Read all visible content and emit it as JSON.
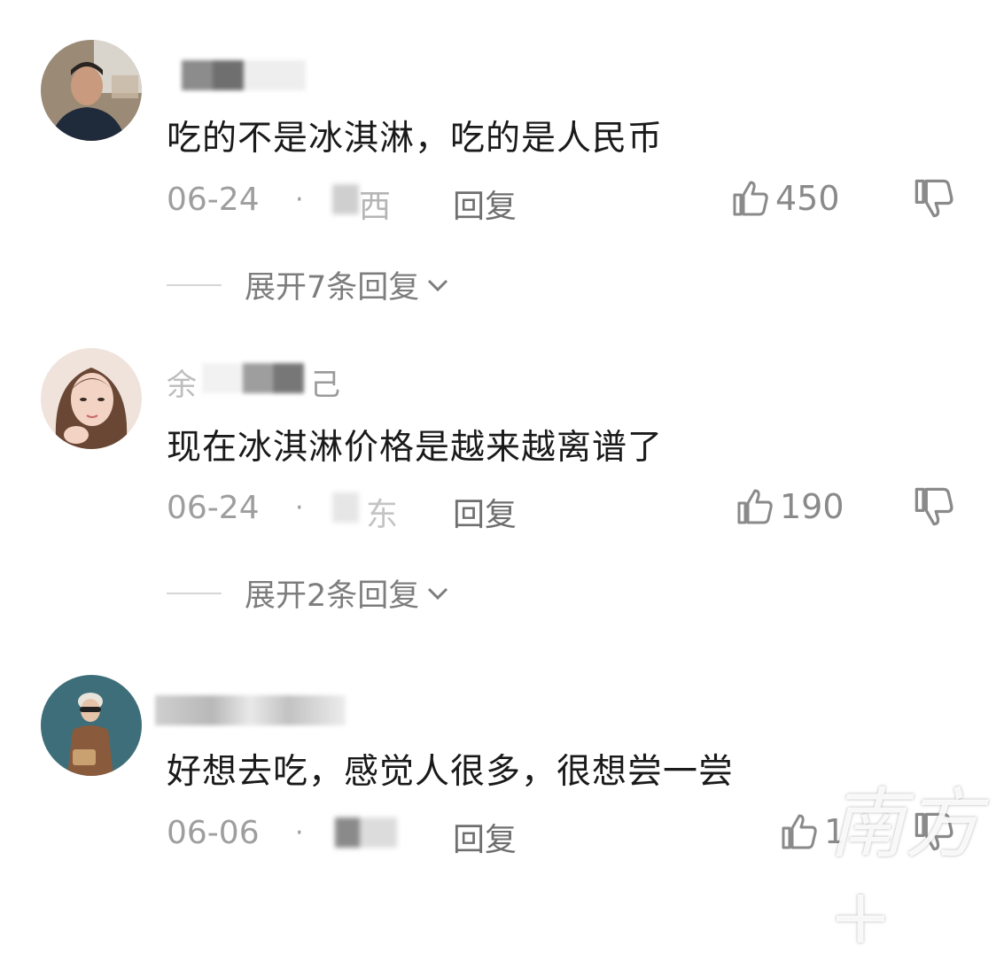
{
  "comments": [
    {
      "text": "吃的不是冰淇淋，吃的是人民币",
      "date": "06-24",
      "separator": "·",
      "location": "西",
      "reply_label": "回复",
      "likes": "450",
      "expand_label": "展开7条回复"
    },
    {
      "name_prefix": "余",
      "name_suffix": "己",
      "text": "现在冰淇淋价格是越来越离谱了",
      "date": "06-24",
      "separator": "·",
      "location": "东",
      "reply_label": "回复",
      "likes": "190",
      "expand_label": "展开2条回复"
    },
    {
      "text": "好想去吃，感觉人很多，很想尝一尝",
      "date": "06-06",
      "separator": "·",
      "reply_label": "回复",
      "likes": "1"
    }
  ],
  "icons": {
    "like": "thumbs-up-icon",
    "dislike": "thumbs-down-icon",
    "expand": "chevron-down-icon"
  },
  "watermark": "南方+"
}
